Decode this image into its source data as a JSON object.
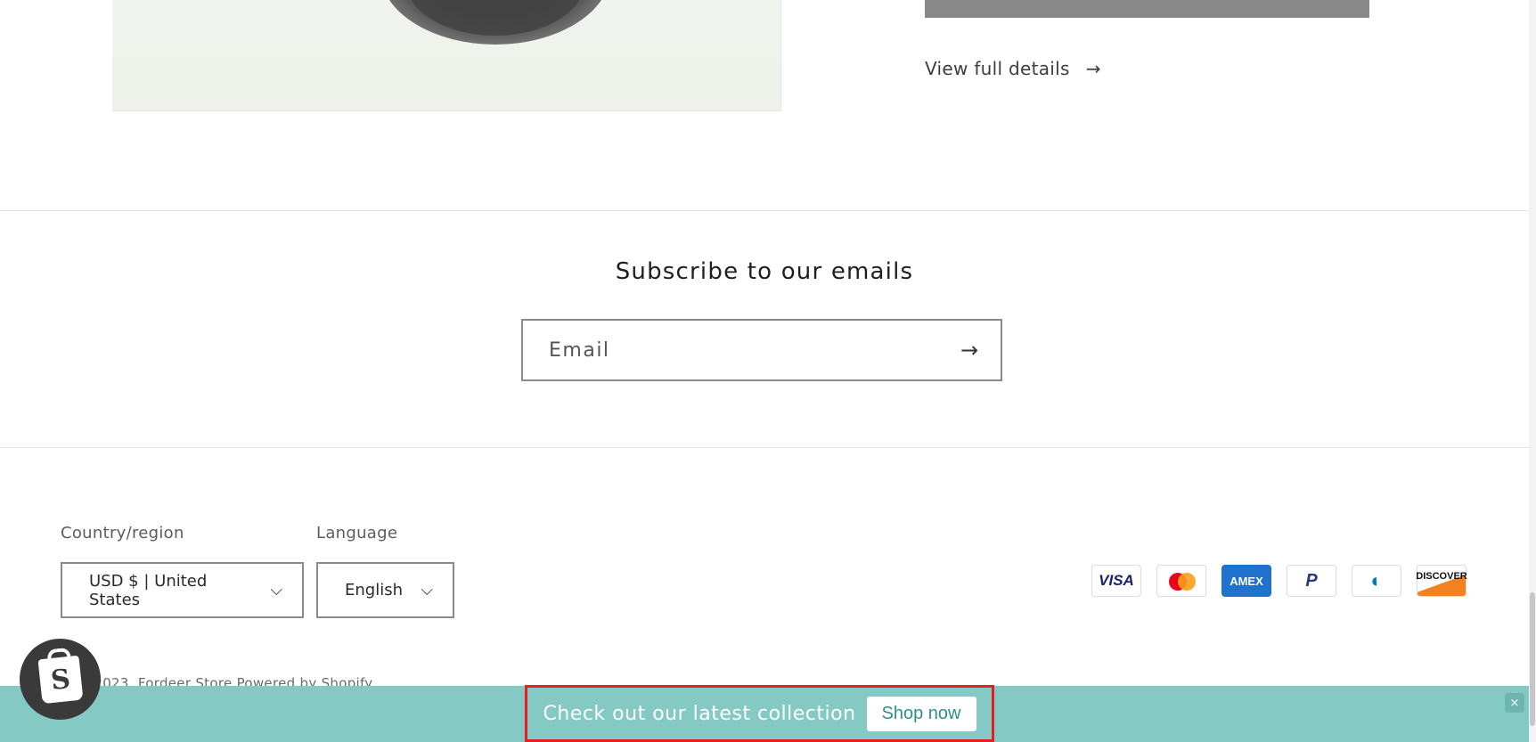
{
  "product": {
    "view_details_label": "View full details",
    "view_details_icon": "arrow-right-icon"
  },
  "newsletter": {
    "heading": "Subscribe to our emails",
    "email_placeholder": "Email",
    "email_value": "",
    "submit_icon": "arrow-right-icon"
  },
  "footer": {
    "country_label": "Country/region",
    "country_value": "USD $ | United States",
    "language_label": "Language",
    "language_value": "English",
    "payment_methods": [
      "Visa",
      "Mastercard",
      "American Express",
      "PayPal",
      "Diners Club",
      "Discover"
    ],
    "copyright": "© 2023, Fordeer Store Powered by Shopify"
  },
  "promo": {
    "text": "Check out our latest collection",
    "button_label": "Shop now",
    "close_label": "×",
    "background_color": "#84c9c3",
    "highlight_color": "#e81d1d"
  },
  "badge": {
    "icon": "shopify-bag-icon",
    "letter": "S"
  }
}
